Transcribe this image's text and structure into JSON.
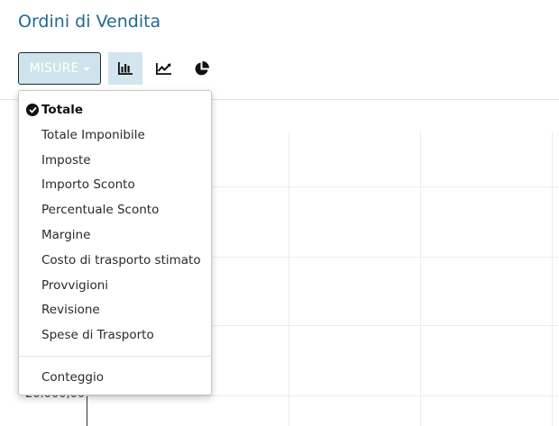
{
  "header": {
    "title": "Ordini di Vendita"
  },
  "toolbar": {
    "measures_label": "MISURE",
    "views": [
      {
        "name": "bar-chart",
        "icon": "bar-chart-icon",
        "active": true
      },
      {
        "name": "line-chart",
        "icon": "line-chart-icon",
        "active": false
      },
      {
        "name": "pie-chart",
        "icon": "pie-chart-icon",
        "active": false
      }
    ]
  },
  "measures_menu": {
    "items": [
      {
        "label": "Totale",
        "selected": true
      },
      {
        "label": "Totale Imponibile",
        "selected": false
      },
      {
        "label": "Imposte",
        "selected": false
      },
      {
        "label": "Importo Sconto",
        "selected": false
      },
      {
        "label": "Percentuale Sconto",
        "selected": false
      },
      {
        "label": "Margine",
        "selected": false
      },
      {
        "label": "Costo di trasporto stimato",
        "selected": false
      },
      {
        "label": "Provvigioni",
        "selected": false
      },
      {
        "label": "Revisione",
        "selected": false
      },
      {
        "label": "Spese di Trasporto",
        "selected": false
      }
    ],
    "count_label": "Conteggio"
  },
  "chart": {
    "y_tick_label": "20.000,00"
  },
  "colors": {
    "title": "#1f6a96",
    "measures_button_bg": "#cfe3ec",
    "active_view_bg": "#d3e5ee"
  }
}
